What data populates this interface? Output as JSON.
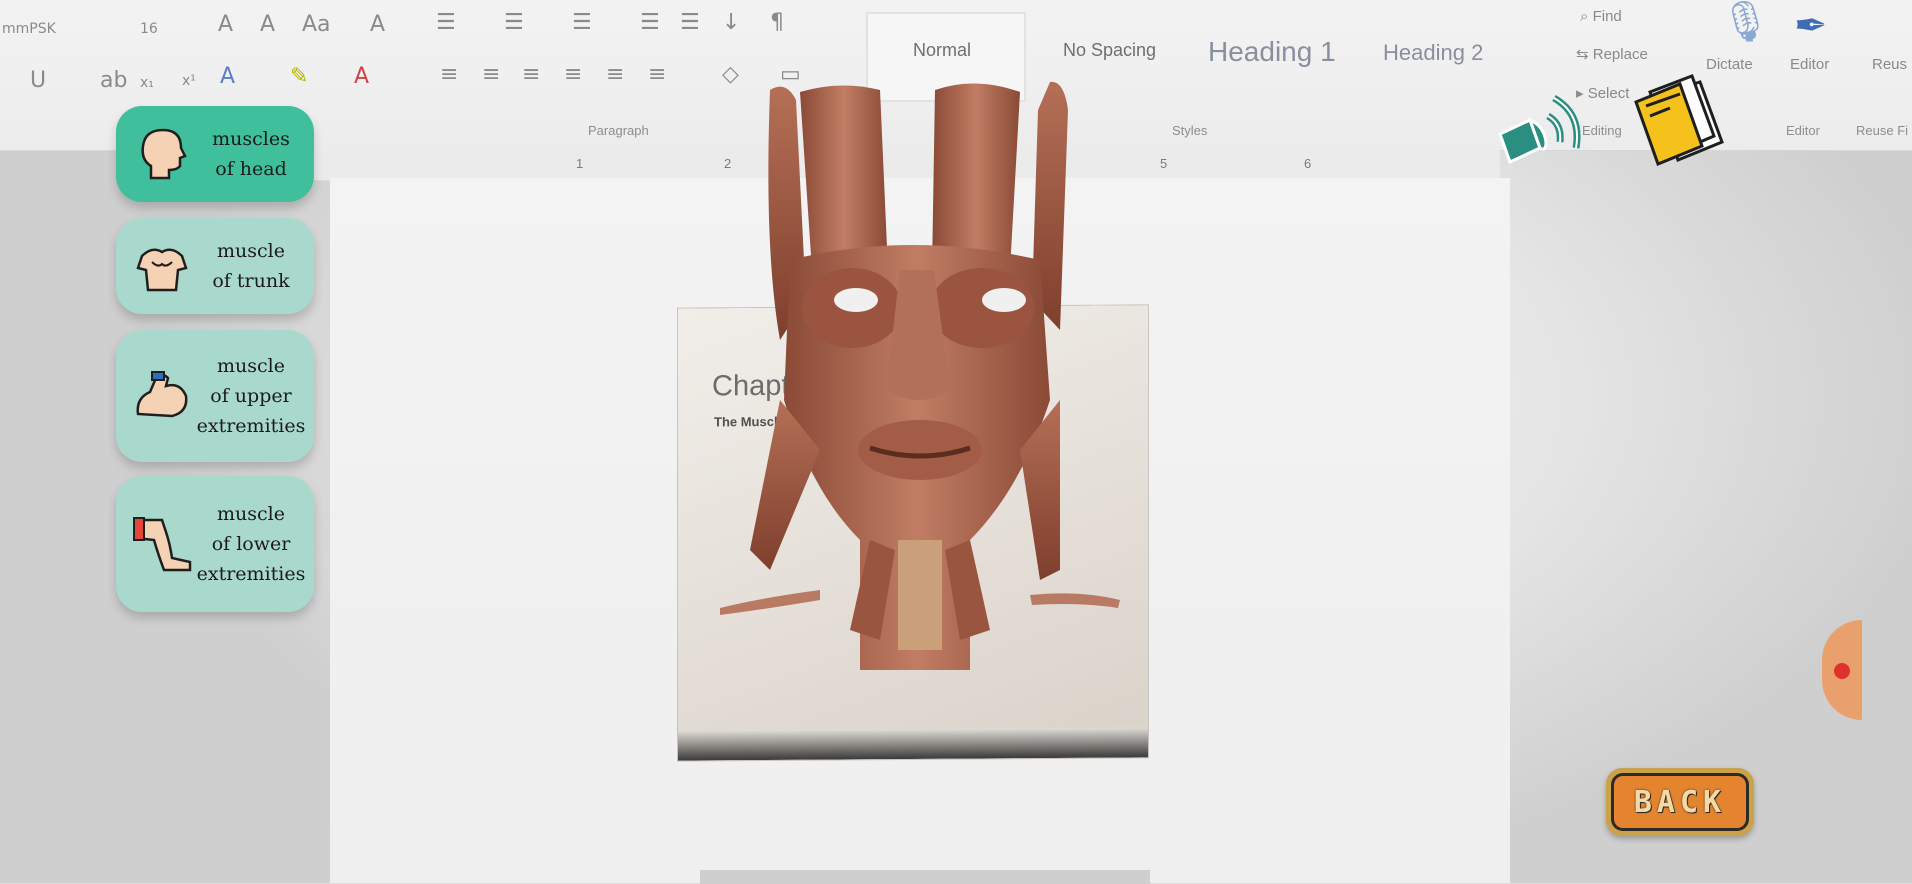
{
  "word": {
    "font_name_partial": "mmPSK",
    "font_size_partial": "16",
    "styles": [
      "Normal",
      "No Spacing",
      "Heading 1",
      "Heading 2"
    ],
    "group_labels": {
      "paragraph": "Paragraph",
      "styles": "Styles",
      "editing": "Editing",
      "editor": "Editor",
      "reuse": "Reuse Fi"
    },
    "editing": {
      "find": "Find",
      "replace": "Replace",
      "select": "Select"
    },
    "tools": {
      "dictate": "Dictate",
      "editor": "Editor",
      "reuse_partial": "Reus Fil"
    },
    "ruler_numbers": [
      "1",
      "2",
      "5",
      "6"
    ],
    "document_chapter_partial": "Chapte",
    "document_subtitle_partial": "The Muscles"
  },
  "menu": {
    "items": [
      {
        "label_line1": "muscles",
        "label_line2": "of head",
        "label_line3": "",
        "icon": "head-icon",
        "active": true
      },
      {
        "label_line1": "muscle",
        "label_line2": "of trunk",
        "label_line3": "",
        "icon": "torso-icon",
        "active": false
      },
      {
        "label_line1": "muscle",
        "label_line2": "of upper",
        "label_line3": "extremities",
        "icon": "arm-icon",
        "active": false
      },
      {
        "label_line1": "muscle",
        "label_line2": "of lower",
        "label_line3": "extremities",
        "icon": "leg-icon",
        "active": false
      }
    ]
  },
  "controls": {
    "audio_icon": "speaker-sound-icon",
    "book_icon": "book-icon",
    "back_label": "BACK"
  },
  "colors": {
    "menu_active": "#3fbf9c",
    "menu_default": "#a9d9cd",
    "back_fill": "#e5842f",
    "back_border": "#c9a24a",
    "speaker": "#2a8f80",
    "book": "#f4c21a"
  }
}
